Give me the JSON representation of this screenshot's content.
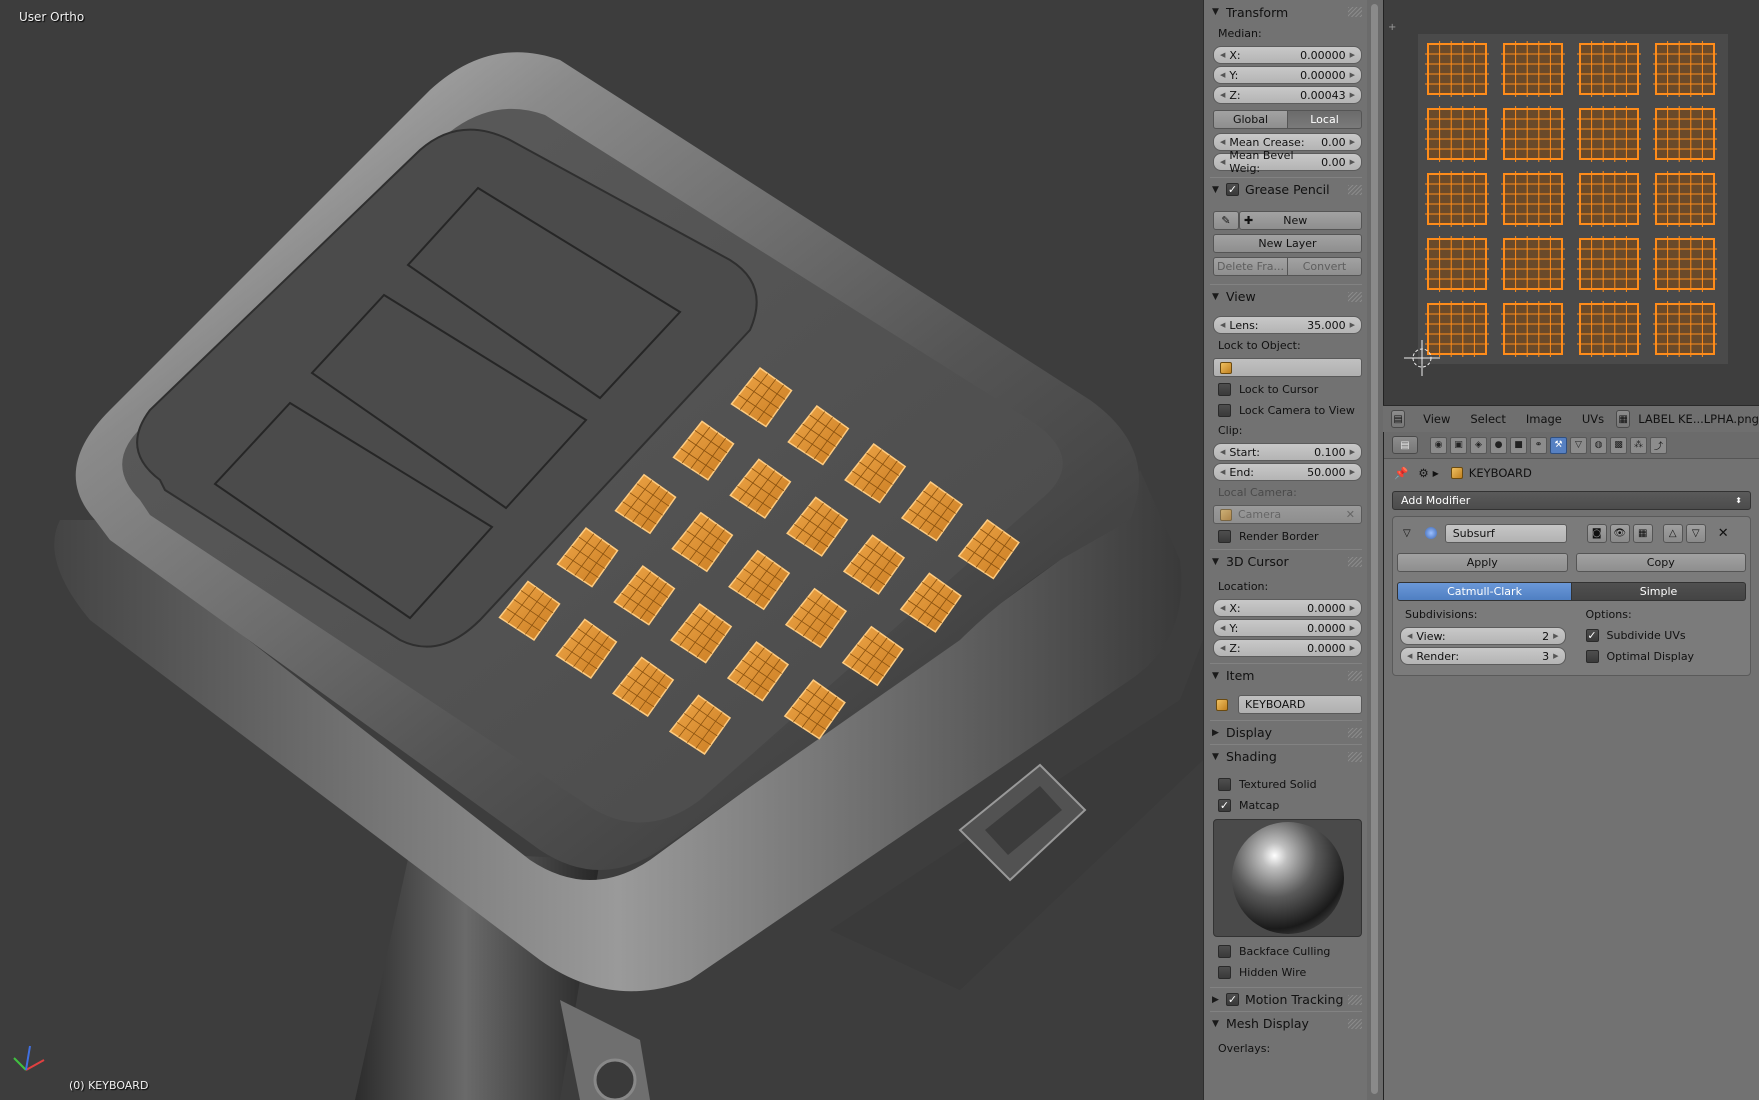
{
  "viewport": {
    "view_label": "User Ortho",
    "object_label": "(0) KEYBOARD"
  },
  "npanel": {
    "transform": {
      "title": "Transform",
      "median_label": "Median:",
      "x_key": "X:",
      "x_val": "0.00000",
      "y_key": "Y:",
      "y_val": "0.00000",
      "z_key": "Z:",
      "z_val": "0.00043",
      "global_btn": "Global",
      "local_btn": "Local",
      "crease_key": "Mean Crease:",
      "crease_val": "0.00",
      "bevel_key": "Mean Bevel Weig:",
      "bevel_val": "0.00"
    },
    "grease": {
      "title": "Grease Pencil",
      "new_btn": "New",
      "new_layer_btn": "New Layer",
      "delete_btn": "Delete Fra...",
      "convert_btn": "Convert"
    },
    "view": {
      "title": "View",
      "lens_key": "Lens:",
      "lens_val": "35.000",
      "lock_label": "Lock to Object:",
      "lock_cursor": "Lock to Cursor",
      "lock_camera": "Lock Camera to View",
      "clip_label": "Clip:",
      "start_key": "Start:",
      "start_val": "0.100",
      "end_key": "End:",
      "end_val": "50.000",
      "local_camera_label": "Local Camera:",
      "camera_field": "Camera",
      "render_border": "Render Border"
    },
    "cursor": {
      "title": "3D Cursor",
      "location_label": "Location:",
      "x_key": "X:",
      "x_val": "0.0000",
      "y_key": "Y:",
      "y_val": "0.0000",
      "z_key": "Z:",
      "z_val": "0.0000"
    },
    "item": {
      "title": "Item",
      "name": "KEYBOARD"
    },
    "display": {
      "title": "Display"
    },
    "shading": {
      "title": "Shading",
      "textured_solid": "Textured Solid",
      "matcap": "Matcap",
      "backface": "Backface Culling",
      "hidden_wire": "Hidden Wire"
    },
    "motion": {
      "title": "Motion Tracking"
    },
    "mesh_display": {
      "title": "Mesh Display",
      "overlays_label": "Overlays:"
    }
  },
  "uv_header": {
    "menus": [
      "View",
      "Select",
      "Image",
      "UVs"
    ],
    "image_name": "LABEL KE...LPHA.png"
  },
  "properties": {
    "object_name": "KEYBOARD",
    "add_modifier": "Add Modifier",
    "modifier_name": "Subsurf",
    "apply_btn": "Apply",
    "copy_btn": "Copy",
    "catmull": "Catmull-Clark",
    "simple": "Simple",
    "subdivisions_label": "Subdivisions:",
    "options_label": "Options:",
    "view_key": "View:",
    "view_val": "2",
    "render_key": "Render:",
    "render_val": "3",
    "subdivide_uvs": "Subdivide UVs",
    "optimal_display": "Optimal Display"
  },
  "colors": {
    "selection": "#e8962e",
    "accent": "#5680c2",
    "panel": "#727272"
  }
}
